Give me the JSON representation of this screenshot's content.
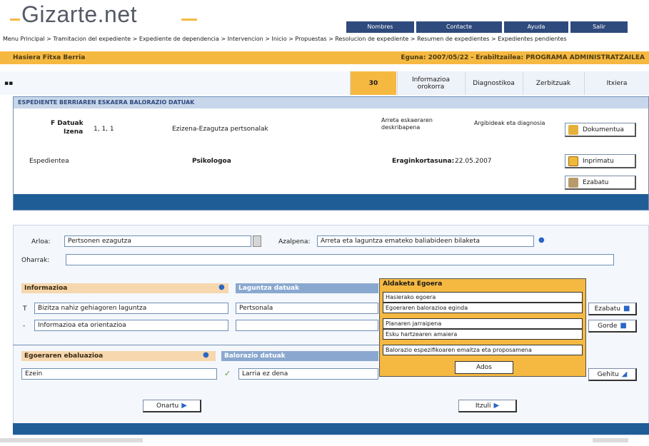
{
  "header": {
    "logo": "Gizarte.net",
    "nav": [
      "Nombres",
      "Contacte",
      "Ayuda",
      "Salir"
    ],
    "breadcrumb": "Menu Principal > Tramitacion del expediente > Expediente de dependencia > Intervencion > Inicio > Propuestas > Resolucion de expediente > Resumen de expedientes > Expedientes pendientes",
    "user_left": "Hasiera Fitxa Berria",
    "user_right": "Eguna: 2007/05/22 - Erabiltzailea: PROGRAMA ADMINISTRATZAILEA"
  },
  "tabs": [
    "30",
    "Informazioa orokorra",
    "Diagnostikoa",
    "Zerbitzuak",
    "Itxiera"
  ],
  "panel1": {
    "title": "ESPEDIENTE BERRIAREN ESKAERA BALORAZIO DATUAK",
    "name_label": "F Datuak",
    "name_sub": "Izena",
    "name_value": "1, 1, 1",
    "center_line": "Ezizena-Ezagutza pertsonalak",
    "desc_label": "Arreta eskaeraren deskribapena",
    "desc_value": "Argibideak eta diagnosia",
    "tipo_label": "Espedientea",
    "tipo_value": "Psikologoa",
    "date_label": "Eraginkortasuna:",
    "date_value": "22.05.2007",
    "buttons": [
      "Dokumentua",
      "Inprimatu",
      "Ezabatu"
    ]
  },
  "panel2": {
    "arloa_label": "Arloa:",
    "arloa_value": "Pertsonen ezagutza",
    "azalpena_label": "Azalpena:",
    "azalpena_value": "Arreta eta laguntza emateko baliabideen bilaketa",
    "oharrak_label": "Oharrak:",
    "left_head": "Informazioa",
    "right_head": "Laguntza datuak",
    "row1_letter": "T",
    "row1_left": "Bizitza nahiz gehiagoren laguntza",
    "row1_mid": "Pertsonala",
    "row2_letter": "-",
    "row2_left": "Informazioa eta orientazioa",
    "btn_row1": "Ezabatu",
    "btn_row2": "Gorde",
    "bottom_left_head": "Egoeraren ebaluazioa",
    "bottom_right_head": "Balorazio datuak",
    "bottom_left_value": "Ezein",
    "bottom_mid_value": "Larria ez dena",
    "bottom_btn": "Gehitu",
    "action_left": "Onartu",
    "action_right": "Itzuli"
  },
  "popup": {
    "title": "Aldaketa Egoera",
    "options": [
      "Hasierako egoera",
      "Egoeraren balorazioa eginda",
      "Planaren jarraipena",
      "Esku hartzearen amaiera",
      "Balorazio espezifikoaren emaitza eta proposamena"
    ],
    "ok_label": "Ados"
  },
  "colors": {
    "accent": "#f5b942",
    "navy": "#2f4a7c",
    "panel_border": "#6f8fb6",
    "footer_blue": "#1f5d97"
  }
}
